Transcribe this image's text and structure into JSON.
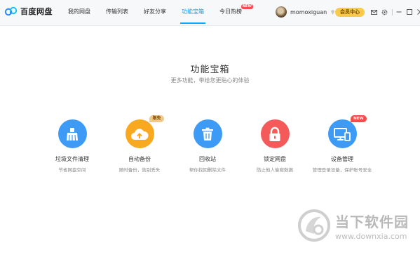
{
  "app": {
    "name": "百度网盘"
  },
  "nav": [
    {
      "label": "我的网盘"
    },
    {
      "label": "传输列表"
    },
    {
      "label": "好友分享"
    },
    {
      "label": "功能宝箱",
      "active": true
    },
    {
      "label": "今日热榜",
      "badge": "NEW"
    }
  ],
  "user": {
    "name": "momoxiguan",
    "vip_label": "会员中心"
  },
  "main": {
    "title": "功能宝箱",
    "subtitle": "更多功能，带给您更贴心的体验",
    "tools": [
      {
        "name": "垃圾文件清理",
        "desc": "节省网盘空间",
        "icon": "broom-icon",
        "color": "#3d9bf5"
      },
      {
        "name": "自动备份",
        "desc": "随时备份，告别丢失",
        "icon": "cloud-upload-icon",
        "color": "#f8a920",
        "tag": "限免"
      },
      {
        "name": "回收站",
        "desc": "帮你找回删除文件",
        "icon": "trash-icon",
        "color": "#3d9bf5"
      },
      {
        "name": "锁定网盘",
        "desc": "防止他人偷窥数据",
        "icon": "lock-icon",
        "color": "#f45a5a"
      },
      {
        "name": "设备管理",
        "desc": "管理登录设备，保护账号安全",
        "icon": "devices-icon",
        "color": "#3d9bf5",
        "tag": "NEW"
      }
    ]
  },
  "watermark": {
    "text": "当下软件园",
    "url": "www.downxia.com"
  },
  "colors": {
    "accent": "#06a7ff",
    "blue": "#3d9bf5",
    "orange": "#f8a920",
    "red": "#f45a5a",
    "vip": "#f8c94a"
  }
}
